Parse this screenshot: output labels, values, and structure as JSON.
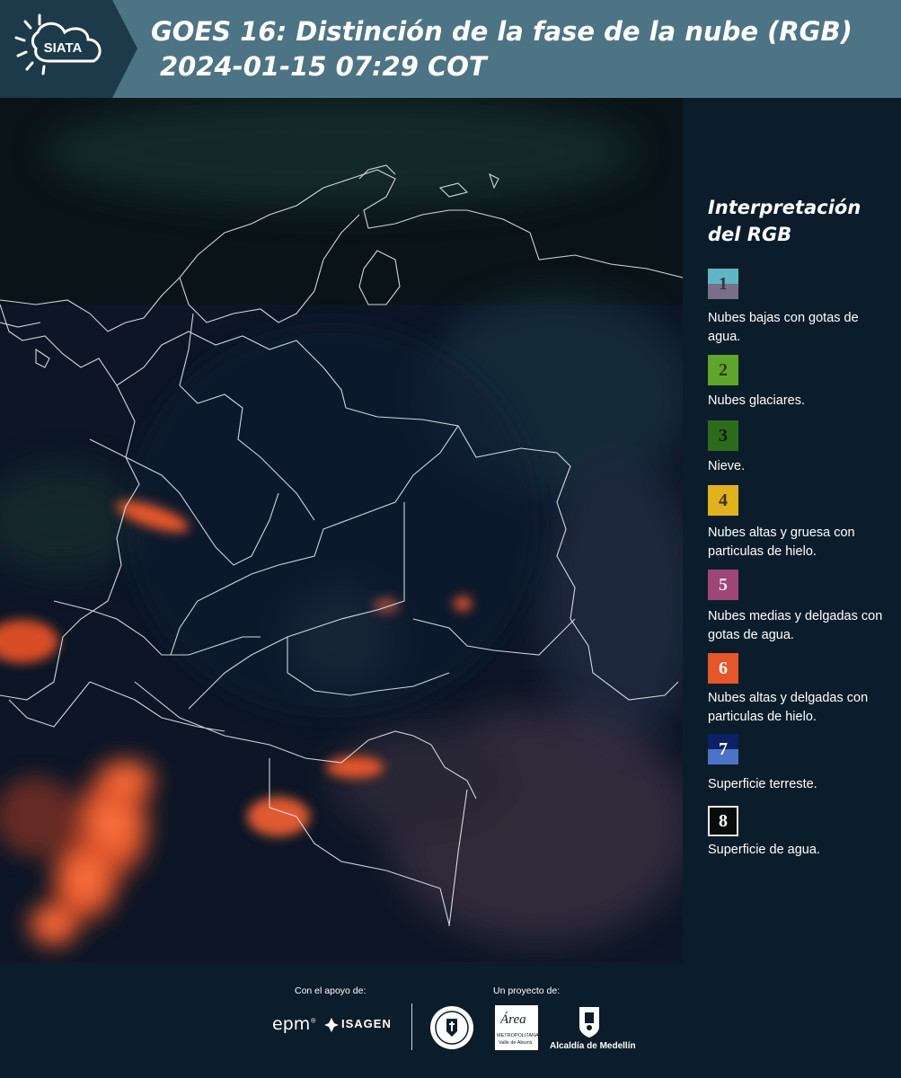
{
  "header": {
    "title": "GOES 16: Distinción de la fase de la nube (RGB)",
    "subtitle": "2024-01-15 07:29 COT",
    "logo_text": "SIATA"
  },
  "legend": {
    "title": "Interpretación del RGB",
    "items": [
      {
        "number": "1",
        "label": "Nubes bajas con gotas de agua.",
        "color_top": "#5fb6c4",
        "color_bottom": "#7a6f8a"
      },
      {
        "number": "2",
        "label": "Nubes glaciares.",
        "color": "#5fa52a"
      },
      {
        "number": "3",
        "label": "Nieve.",
        "color": "#2e6a1c"
      },
      {
        "number": "4",
        "label": "Nubes altas y gruesa con particulas de hielo.",
        "color": "#e0b21c"
      },
      {
        "number": "5",
        "label": "Nubes medias y delgadas con gotas de agua.",
        "color": "#9e4675"
      },
      {
        "number": "6",
        "label": "Nubes altas y delgadas con particulas de hielo.",
        "color": "#e5562a"
      },
      {
        "number": "7",
        "label": "Superficie terreste.",
        "color_top": "#0c2166",
        "color_bottom": "#4f72c9"
      },
      {
        "number": "8",
        "label": "Superficie de agua.",
        "color": "#060d0a"
      }
    ]
  },
  "footer": {
    "support_label": "Con el apoyo de:",
    "project_label": "Un proyecto de:",
    "brand_epm": "epm",
    "brand_isagen": "ISAGEN",
    "brand_area": "Área",
    "brand_area_sub": "METROPOLITANA",
    "brand_area_sub2": "Valle de Aburrá",
    "brand_alcaldia": "Alcaldía de Medellín"
  },
  "colors": {
    "header_bg": "#4d7484",
    "page_bg": "#0b1d2a",
    "cloud_ice_thin": "#e5562a",
    "land_dark": "#0d1a30"
  }
}
